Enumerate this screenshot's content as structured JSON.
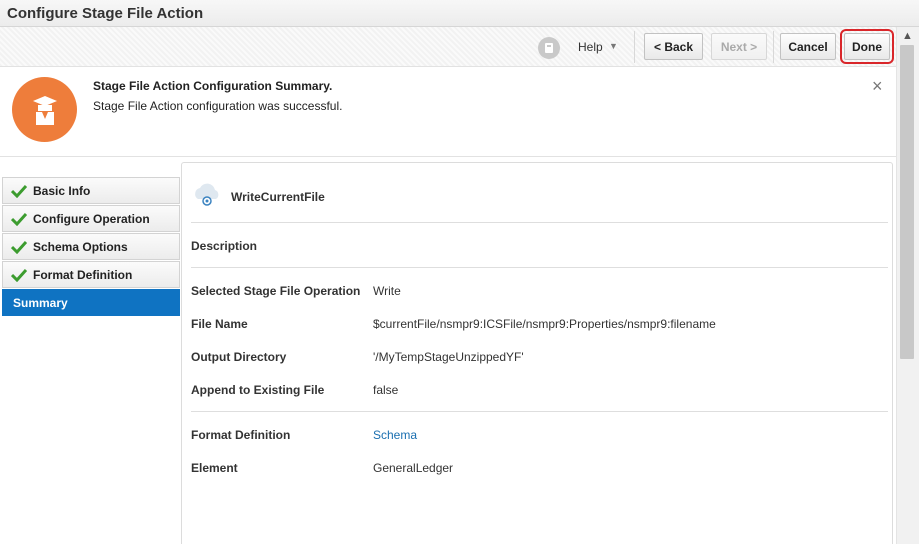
{
  "window": {
    "title": "Configure Stage File Action"
  },
  "toolbar": {
    "help_label": "Help",
    "back_label": "< Back",
    "next_label": "Next >",
    "cancel_label": "Cancel",
    "done_label": "Done"
  },
  "banner": {
    "title": "Stage File Action Configuration Summary.",
    "message": "Stage File Action configuration was successful.",
    "close_label": "×"
  },
  "wizard": {
    "steps": [
      {
        "label": "Basic Info",
        "done": true
      },
      {
        "label": "Configure Operation",
        "done": true
      },
      {
        "label": "Schema Options",
        "done": true
      },
      {
        "label": "Format Definition",
        "done": true
      },
      {
        "label": "Summary",
        "active": true
      }
    ]
  },
  "summary": {
    "action_name": "WriteCurrentFile",
    "description_label": "Description",
    "rows": [
      {
        "label": "Selected Stage File Operation",
        "value": "Write"
      },
      {
        "label": "File Name",
        "value": "$currentFile/nsmpr9:ICSFile/nsmpr9:Properties/nsmpr9:filename"
      },
      {
        "label": "Output Directory",
        "value": "'/MyTempStageUnzippedYF'"
      },
      {
        "label": "Append to Existing File",
        "value": "false"
      },
      {
        "label": "Format Definition",
        "value": "Schema"
      },
      {
        "label": "Element",
        "value": "GeneralLedger"
      }
    ]
  },
  "colors": {
    "accent": "#0f73c2",
    "banner_icon": "#ee7d3b",
    "highlight": "#d9262a",
    "link": "#1a6fb0"
  },
  "icons": [
    "help-icon",
    "close-icon",
    "check-icon",
    "cloud-icon",
    "user-icon",
    "scroll-up-icon"
  ]
}
